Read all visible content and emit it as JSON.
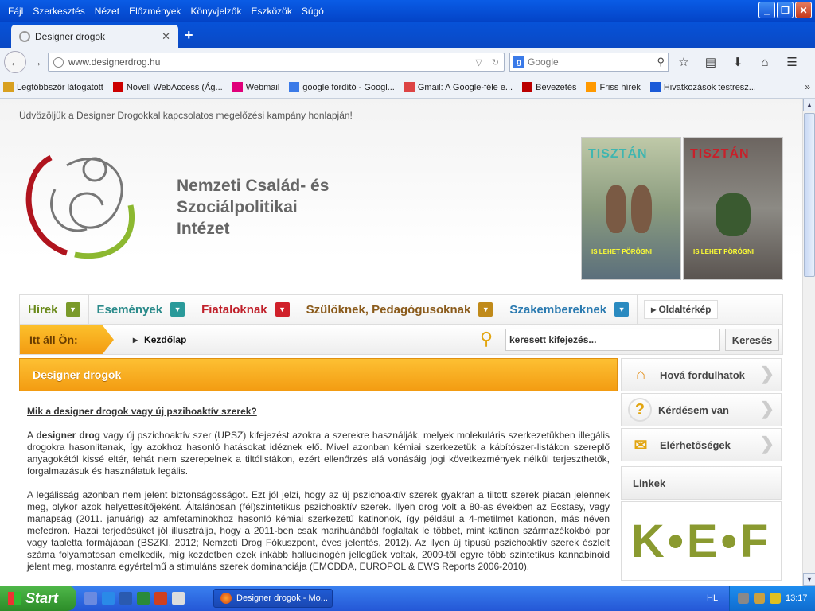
{
  "browser": {
    "menu": [
      "Fájl",
      "Szerkesztés",
      "Nézet",
      "Előzmények",
      "Könyvjelzők",
      "Eszközök",
      "Súgó"
    ],
    "tab_title": "Designer drogok",
    "url": "www.designerdrog.hu",
    "search_placeholder": "Google",
    "bookmarks": [
      {
        "label": "Legtöbbször látogatott",
        "icon": "bookmark-folder-icon"
      },
      {
        "label": "Novell WebAccess (Ág...",
        "icon": "novell-icon"
      },
      {
        "label": "Webmail",
        "icon": "telekom-icon"
      },
      {
        "label": "google fordító - Googl...",
        "icon": "google-icon"
      },
      {
        "label": "Gmail: A Google-féle e...",
        "icon": "gmail-icon"
      },
      {
        "label": "Bevezetés",
        "icon": "redhat-icon"
      },
      {
        "label": "Friss hírek",
        "icon": "rss-icon"
      },
      {
        "label": "Hivatkozások testresz...",
        "icon": "ms-icon"
      }
    ]
  },
  "page": {
    "welcome": "Üdvözöljük a Designer Drogokkal kapcsolatos megelőzési kampány honlapján!",
    "org_name": [
      "Nemzeti Család- és",
      "Szociálpolitikai",
      "Intézet"
    ],
    "posters": [
      {
        "title": "TISZTÁN",
        "subtitle": "IS LEHET PÖRÖGNI"
      },
      {
        "title": "TISZTÁN",
        "subtitle": "IS LEHET PÖRÖGNI"
      }
    ],
    "nav": [
      {
        "label": "Hírek",
        "color": "#6a8a1a",
        "arrow_color": "#7a9a2a"
      },
      {
        "label": "Események",
        "color": "#2a8a8a",
        "arrow_color": "#2a9a9a"
      },
      {
        "label": "Fiataloknak",
        "color": "#c0202a",
        "arrow_color": "#d0202a"
      },
      {
        "label": "Szülőknek, Pedagógusoknak",
        "color": "#8a5a1a",
        "arrow_color": "#c08a1a"
      },
      {
        "label": "Szakembereknek",
        "color": "#2a7ab0",
        "arrow_color": "#2a8ac0"
      }
    ],
    "sitemap": "Oldaltérkép",
    "crumb_label": "Itt áll Ön:",
    "crumb_home": "Kezdőlap",
    "site_search_value": "keresett kifejezés...",
    "site_search_button": "Keresés",
    "content_title": "Designer drogok",
    "question": "Mik a designer drogok vagy új pszihoaktív szerek?",
    "para1_pre": "A ",
    "para1_bold": "designer drog",
    "para1_rest": " vagy új pszichoaktív szer (UPSZ) kifejezést azokra a szerekre használják, melyek molekuláris szerkezetükben illegális drogokra hasonlítanak, így azokhoz hasonló hatásokat idéznek elő. Mivel azonban kémiai szerkezetük a kábítószer-listákon szereplő anyagokétól kissé eltér, tehát nem szerepelnek a tiltólistákon, ezért ellenőrzés alá vonásáig jogi következmények nélkül terjeszthetők, forgalmazásuk és használatuk legális.",
    "para2": "A legálisság azonban nem jelent biztonságosságot. Ezt jól jelzi, hogy az új pszichoaktív szerek gyakran a tiltott szerek piacán jelennek meg, olykor azok helyettesítőjeként. Általánosan (fél)szintetikus pszichoaktív szerek. Ilyen drog volt a 80-as években az Ecstasy, vagy manapság (2011. januárig) az amfetaminokhoz hasonló kémiai szerkezetű katinonok, így például a 4-metilmet kationon, más néven mefedron. Hazai terjedésüket jól illusztrálja, hogy a 2011-ben csak marihuánából foglaltak le többet, mint katinon származékokból por vagy tabletta formájában (BSZKI, 2012; Nemzeti Drog Fókuszpont, éves jelentés, 2012). Az ilyen új típusú pszichoaktív szerek észlelt száma folyamatosan emelkedik, míg kezdetben ezek inkább hallucinogén jellegűek voltak, 2009-től egyre több szintetikus kannabinoid jelent meg, mostanra egyértelmű a stimuláns szerek dominanciája (EMCDDA, EUROPOL & EWS Reports 2006-2010).",
    "sidebar": [
      {
        "label": "Hová fordulhatok",
        "icon": "house-icon"
      },
      {
        "label": "Kérdésem van",
        "icon": "question-icon"
      },
      {
        "label": "Elérhetőségek",
        "icon": "envelope-icon"
      }
    ],
    "links_title": "Linkek",
    "kef_logo": "K•E•F"
  },
  "taskbar": {
    "start": "Start",
    "task": "Designer drogok - Mo...",
    "lang": "HL",
    "time": "13:17"
  }
}
